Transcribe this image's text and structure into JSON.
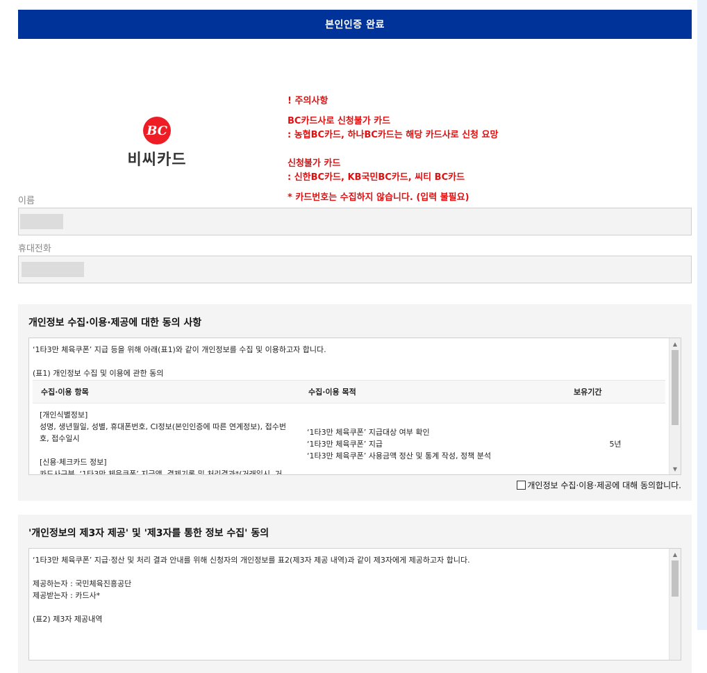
{
  "header": {
    "title": "본인인증 완료"
  },
  "card": {
    "logo_mark": "BC",
    "logo_text": "비씨카드",
    "notice": {
      "warning": "! 주의사항",
      "line1": "BC카드사로 신청불가 카드",
      "line2": ": 농협BC카드, 하나BC카드는 해당 카드사로 신청 요망",
      "line3": "신청불가 카드",
      "line4": ": 신한BC카드, KB국민BC카드, 씨티 BC카드",
      "line5": "* 카드번호는 수집하지 않습니다. (입력 불필요)"
    }
  },
  "form": {
    "name_label": "이름",
    "phone_label": "휴대전화"
  },
  "consent1": {
    "title": "개인정보 수집·이용·제공에 대한 동의 사항",
    "intro": "‘1타3만 체육쿠폰’ 지급 등을 위해 아래(표1)와 같이 개인정보를 수집 및 이용하고자 합니다.",
    "table_caption": "(표1) 개인정보 수집 및 이용에 관한 동의",
    "columns": [
      "수집·이용 항목",
      "수집·이용 목적",
      "보유기간"
    ],
    "row": {
      "item_header1": "[개인식별정보]",
      "item_text1a": "성명, 생년월일, 성별, 휴대폰번호, CI정보(본인인증에 따른 연계정보), 접수번",
      "item_text1b": "호, 접수일시",
      "item_header2": "[신용·체크카드 정보]",
      "item_text2": "카드사구분, ‘1타3만 체육쿠폰’ 지급액, 결제기록 및 처리결과*(거래일시, 거",
      "purpose1": "‘1타3만 체육쿠폰’ 지급대상 여부 확인",
      "purpose2": "‘1타3만 체육쿠폰’ 지급",
      "purpose3": "‘1타3만 체육쿠폰’ 사용금액 정산 및 통계 작성, 정책 분석",
      "period": "5년"
    },
    "agree_label": "개인정보 수집·이용·제공에 대해 동의합니다."
  },
  "consent2": {
    "title": "'개인정보의 제3자 제공' 및 '제3자를 통한 정보 수집' 동의",
    "intro": "‘1타3만 체육쿠폰’ 지급·정산 및 처리 결과 안내를 위해 신청자의 개인정보를 표2(제3자 제공 내역)과 같이 제3자에게 제공하고자 합니다.",
    "provider": "제공하는자 : 국민체육진흥공단",
    "receiver": "제공받는자 : 카드사*",
    "table_caption": "(표2) 제3자 제공내역"
  }
}
